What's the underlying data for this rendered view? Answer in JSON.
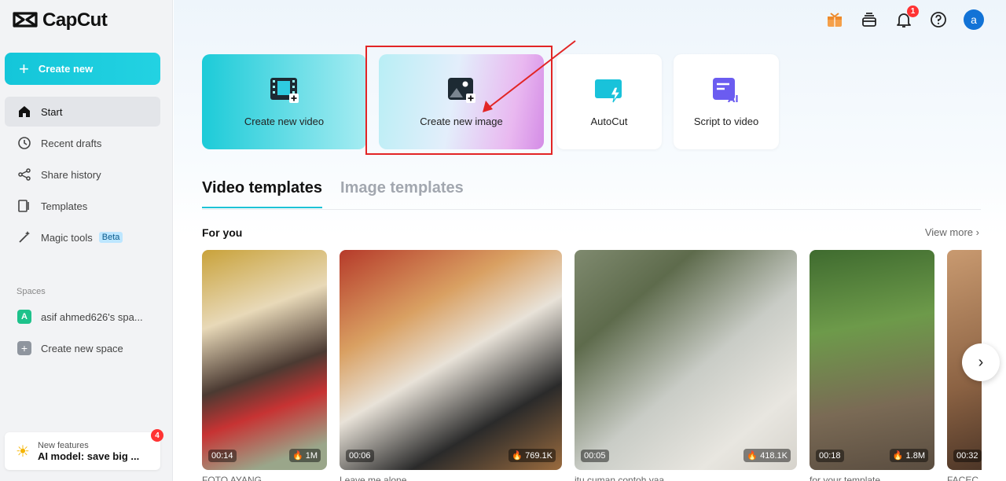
{
  "app": {
    "name": "CapCut"
  },
  "sidebar": {
    "create_label": "Create new",
    "items": [
      {
        "label": "Start",
        "icon": "home-icon"
      },
      {
        "label": "Recent drafts",
        "icon": "clock-icon"
      },
      {
        "label": "Share history",
        "icon": "share-icon"
      },
      {
        "label": "Templates",
        "icon": "template-icon"
      },
      {
        "label": "Magic tools",
        "icon": "magic-wand-icon",
        "badge": "Beta"
      }
    ],
    "spaces_label": "Spaces",
    "space_name": "asif ahmed626's spa...",
    "space_avatar": "A",
    "create_space_label": "Create new space",
    "features": {
      "title": "New features",
      "subtitle": "AI model: save big ...",
      "badge": "4"
    }
  },
  "header": {
    "bell_badge": "1",
    "avatar_letter": "a"
  },
  "cards": {
    "video": "Create new video",
    "image": "Create new image",
    "autocut": "AutoCut",
    "script": "Script to video"
  },
  "tabs": {
    "video": "Video templates",
    "image": "Image templates"
  },
  "section": {
    "title": "For you",
    "view_more": "View more"
  },
  "templates": [
    {
      "duration": "00:14",
      "likes": "1M",
      "caption": "FOTO AYANG..."
    },
    {
      "duration": "00:06",
      "likes": "769.1K",
      "caption": "Leave me alone"
    },
    {
      "duration": "00:05",
      "likes": "418.1K",
      "caption": "itu cuman contoh yaa"
    },
    {
      "duration": "00:18",
      "likes": "1.8M",
      "caption": "for your template"
    },
    {
      "duration": "00:32",
      "likes": "",
      "caption": "FACEC..."
    }
  ]
}
